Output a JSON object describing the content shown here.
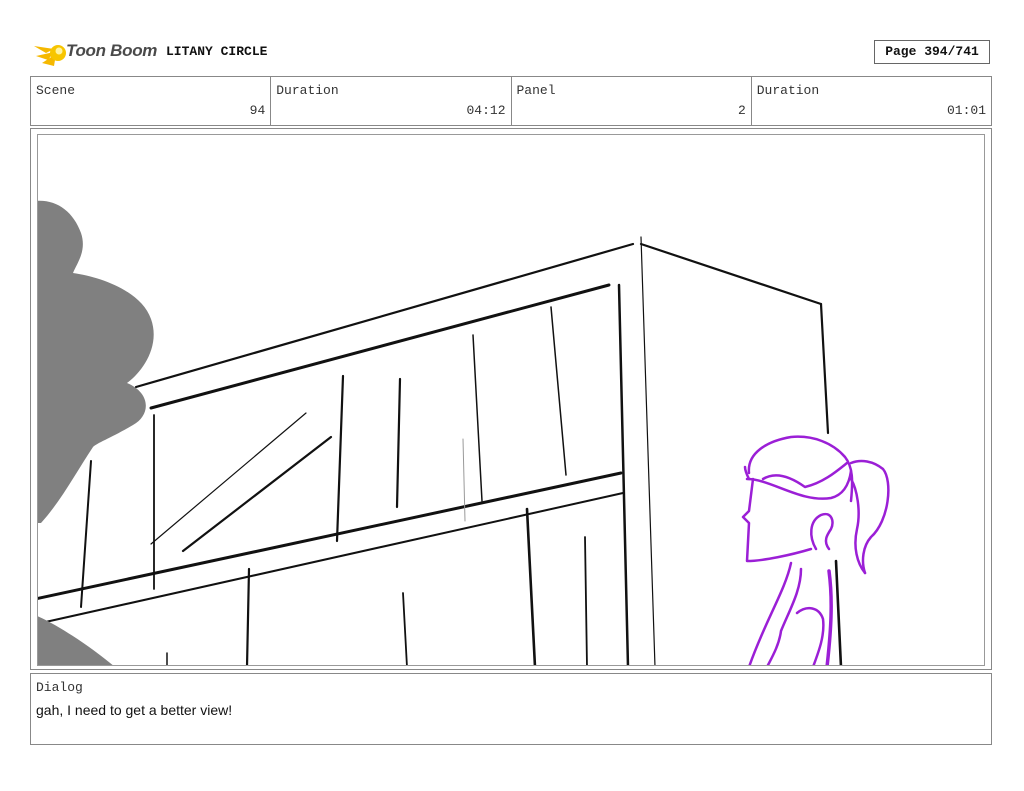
{
  "header": {
    "logo_text": "Toon Boom",
    "project_title": "LITANY CIRCLE",
    "page_label": "Page 394/741"
  },
  "info": {
    "scene_label": "Scene",
    "scene_value": "94",
    "duration_label": "Duration",
    "duration_value": "04:12",
    "panel_label": "Panel",
    "panel_value": "2",
    "panel_duration_label": "Duration",
    "panel_duration_value": "01:01"
  },
  "dialog": {
    "label": "Dialog",
    "text": "gah, I need to get a better view!"
  },
  "colors": {
    "logo_yellow": "#f5b800",
    "silhouette": "#808080",
    "character": "#9b1fd6",
    "ink": "#111111"
  }
}
